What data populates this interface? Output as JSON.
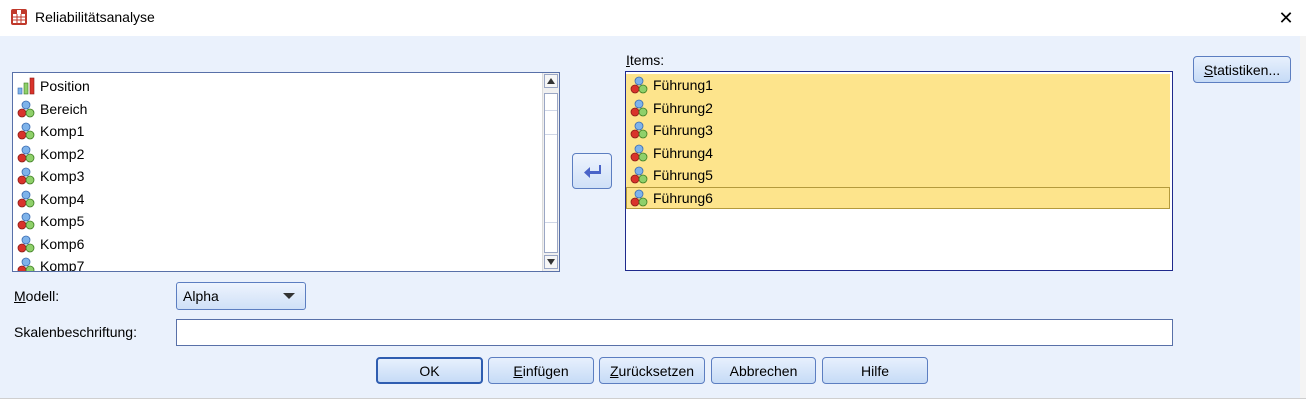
{
  "window": {
    "title": "Reliabilitätsanalyse",
    "close_glyph": "✕"
  },
  "source_list": {
    "items": [
      {
        "label": "Position",
        "icon": "ordinal-bar-icon"
      },
      {
        "label": "Bereich",
        "icon": "nominal-variable-icon"
      },
      {
        "label": "Komp1",
        "icon": "nominal-variable-icon"
      },
      {
        "label": "Komp2",
        "icon": "nominal-variable-icon"
      },
      {
        "label": "Komp3",
        "icon": "nominal-variable-icon"
      },
      {
        "label": "Komp4",
        "icon": "nominal-variable-icon"
      },
      {
        "label": "Komp5",
        "icon": "nominal-variable-icon"
      },
      {
        "label": "Komp6",
        "icon": "nominal-variable-icon"
      },
      {
        "label": "Komp7",
        "icon": "nominal-variable-icon"
      }
    ]
  },
  "items_panel": {
    "label_key": "I",
    "label_rest": "tems:",
    "items": [
      {
        "label": "Führung1"
      },
      {
        "label": "Führung2"
      },
      {
        "label": "Führung3"
      },
      {
        "label": "Führung4"
      },
      {
        "label": "Führung5"
      },
      {
        "label": "Führung6"
      }
    ]
  },
  "buttons": {
    "statistiken_key": "S",
    "statistiken_rest": "tatistiken...",
    "ok": "OK",
    "einfuegen_key": "E",
    "einfuegen_rest": "infügen",
    "zuruecksetzen_key": "Z",
    "zuruecksetzen_rest": "urücksetzen",
    "abbrechen": "Abbrechen",
    "hilfe": "Hilfe"
  },
  "model": {
    "label_key": "M",
    "label_rest": "odell:",
    "value": "Alpha"
  },
  "scale_label": {
    "label": "Skalenbeschriftung:",
    "value": ""
  },
  "colors": {
    "dialog_bg": "#eaf1fc",
    "selected_bg": "#fde48c",
    "accent": "#2f5db0"
  }
}
